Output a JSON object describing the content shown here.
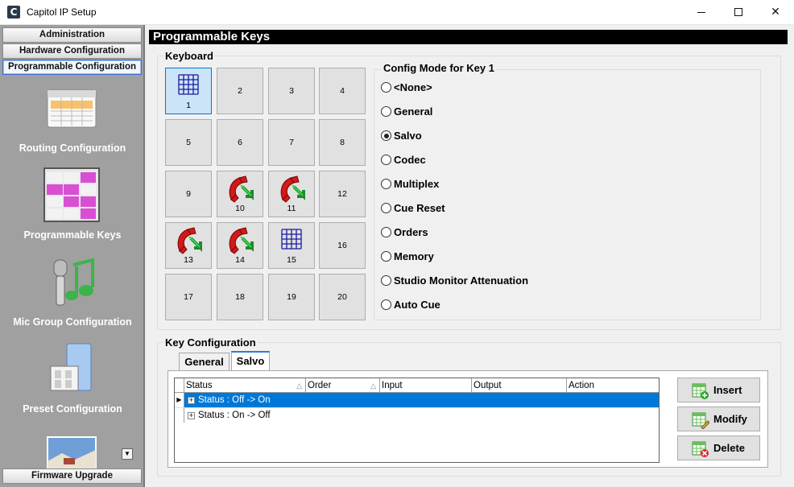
{
  "window": {
    "title": "Capitol IP Setup",
    "icon_letter": "C"
  },
  "sidebar": {
    "nav_top": [
      {
        "label": "Administration"
      },
      {
        "label": "Hardware Configuration"
      },
      {
        "label": "Programmable Configuration"
      }
    ],
    "items": [
      {
        "label": "Routing Configuration",
        "icon": "routing-table-icon"
      },
      {
        "label": "Programmable Keys",
        "icon": "programmable-keys-icon"
      },
      {
        "label": "Mic Group Configuration",
        "icon": "mic-group-icon"
      },
      {
        "label": "Preset Configuration",
        "icon": "preset-icon"
      }
    ],
    "nav_bottom": {
      "label": "Firmware Upgrade"
    },
    "scroll_arrow": "▼"
  },
  "main": {
    "title": "Programmable Keys",
    "keyboard": {
      "title": "Keyboard",
      "keys": [
        "1",
        "2",
        "3",
        "4",
        "5",
        "6",
        "7",
        "8",
        "9",
        "10",
        "11",
        "12",
        "13",
        "14",
        "15",
        "16",
        "17",
        "18",
        "19",
        "20"
      ],
      "selected_key": "1"
    },
    "config_mode": {
      "title": "Config Mode for Key 1",
      "options": [
        "<None>",
        "General",
        "Salvo",
        "Codec",
        "Multiplex",
        "Cue Reset",
        "Orders",
        "Memory",
        "Studio Monitor Attenuation",
        "Auto Cue"
      ],
      "selected": "Salvo"
    },
    "key_configuration": {
      "title": "Key Configuration",
      "tabs": [
        "General",
        "Salvo"
      ],
      "active_tab": "Salvo",
      "columns": [
        "Status",
        "Order",
        "Input",
        "Output",
        "Action"
      ],
      "rows": [
        {
          "status": "Status : Off -> On",
          "selected": true
        },
        {
          "status": "Status : On -> Off",
          "selected": false
        }
      ],
      "buttons": {
        "insert": "Insert",
        "modify": "Modify",
        "delete": "Delete"
      }
    }
  }
}
